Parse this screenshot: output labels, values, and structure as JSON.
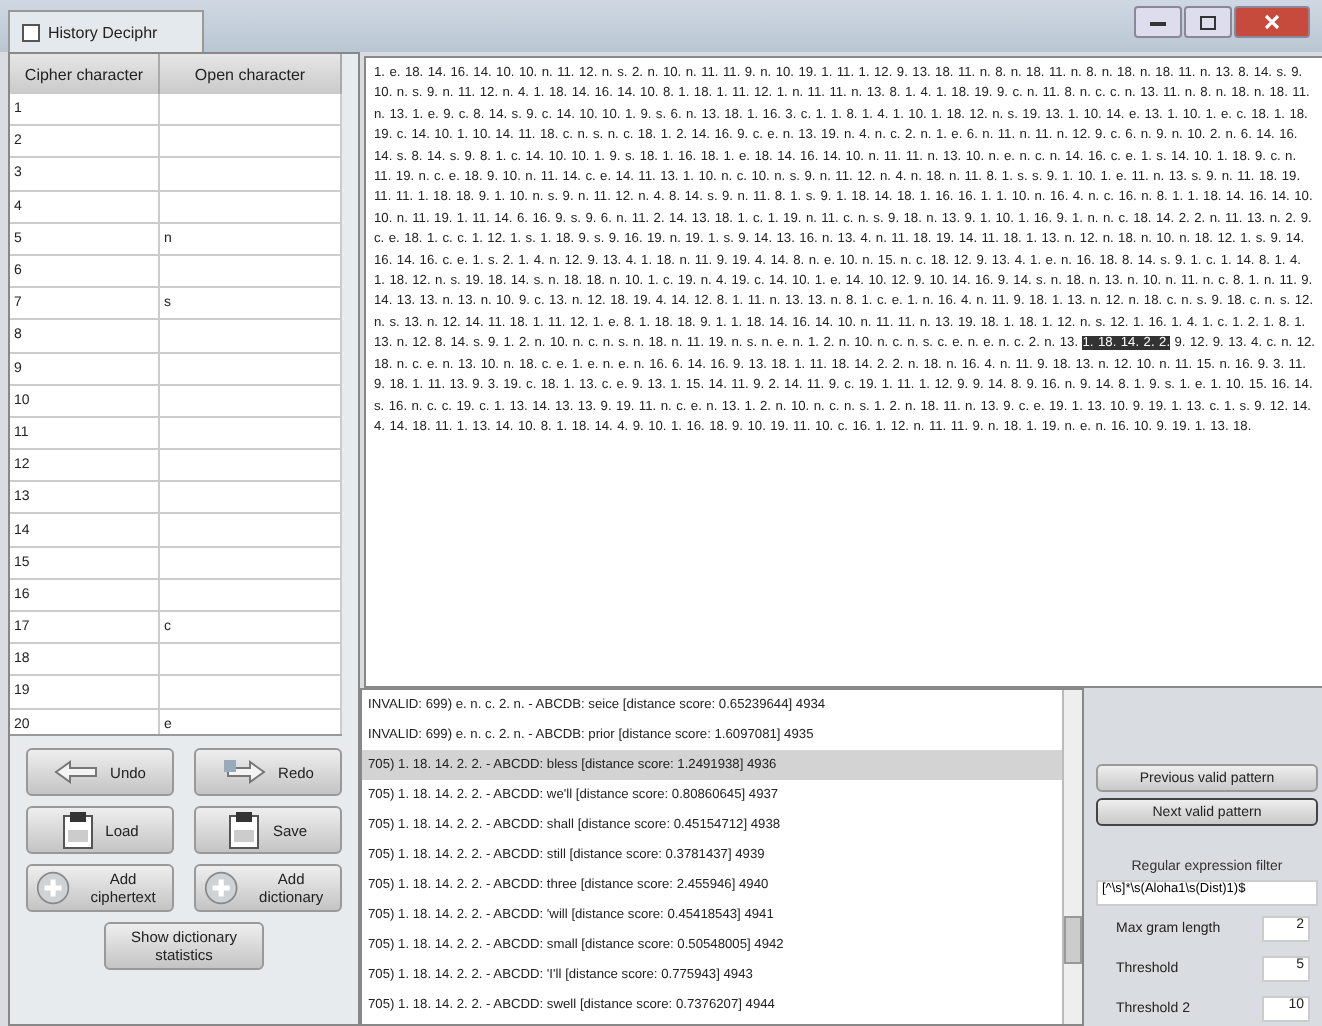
{
  "window": {
    "title": "History Deciphr"
  },
  "table": {
    "columns": [
      "Cipher character",
      "Open character"
    ],
    "rows": [
      {
        "cipher": "1"
      },
      {
        "cipher": "2"
      },
      {
        "cipher": "3"
      },
      {
        "cipher": "4"
      },
      {
        "cipher": "5",
        "open": "n"
      },
      {
        "cipher": "6"
      },
      {
        "cipher": "7",
        "open": "s"
      },
      {
        "cipher": "8"
      },
      {
        "cipher": "9"
      },
      {
        "cipher": "10"
      },
      {
        "cipher": "11"
      },
      {
        "cipher": "12"
      },
      {
        "cipher": "13"
      },
      {
        "cipher": "14"
      },
      {
        "cipher": "15"
      },
      {
        "cipher": "16"
      },
      {
        "cipher": "17",
        "open": "c"
      },
      {
        "cipher": "18"
      },
      {
        "cipher": "19"
      },
      {
        "cipher": "20",
        "open": "e"
      }
    ]
  },
  "buttons": [
    {
      "label": "Undo",
      "kind": "undo"
    },
    {
      "label": "Redo",
      "kind": "redo"
    },
    {
      "label": "Load",
      "kind": "load"
    },
    {
      "label": "Save",
      "kind": "save"
    },
    {
      "label": "Add ciphertext",
      "kind": "add"
    },
    {
      "label": "Add dictionary",
      "kind": "add"
    },
    {
      "label": "Show dictionary statistics",
      "kind": "text"
    }
  ],
  "cipher_text": {
    "before": "1. e. 18. 14. 16. 14. 10. 10. n. 11. 12. n. s. 2. n. 10. n. 11. 11. 9. n. 10. 19. 1. 11. 1. 12. 9. 13. 18. 11. n. 8. n. 18. 11. n. 8. n. 18. n. 18. 11. n. 13. 8. 14. s. 9. 10. n. s. 9. n. 11. 12. n. 4. 1. 18. 14. 16. 14. 10. 8. 1. 18. 1. 11. 12. 1. n. 11. 11. n. 13. 8. 1. 4. 1. 18. 19. 9. c. n. 11. 8. n. c. c. n. 13. 11. n. 8. n. 18. n. 18. 11. n. 13. 1. e. 9. c. 8. 14. s. 9. c. 14. 10. 10. 1. 9. s. 6. n. 13. 18. 1. 16. 3. c. 1. 1. 8. 1. 4. 1. 10. 1. 18. 12. n. s. 19. 13. 1. 10. 14. e. 13. 1. 10. 1. e. c. 18. 1. 18. 19. c. 14. 10. 1. 10. 14. 11. 18. c. n. s. n. c. 18. 1. 2. 14. 16. 9. c. e. n. 13. 19. n. 4. n. c. 2. n. 1. e. 6. n. 11. n. 11. n. 12. 9. c. 6. n. 9. n. 10. 2. n. 6. 14. 16. 14. s. 8. 14. s. 9. 8. 1. c. 14. 10. 10. 1. 9. s. 18. 1. 16. 18. 1. e. 18. 14. 16. 14. 10. n. 11. 11. n. 13. 10. n. e. n. c. n. 14. 16. c. e. 1. s. 14. 10. 1. 18. 9. c. n. 11. 19. n. c. e. 18. 9. 10. n. 11. 14. c. e. 14. 11. 13. 1. 10. n. c. 10. n. s. 9. n. 11. 12. n. 4. n. 18. n. 11. 8. 1. s. s. 9. 1. 10. 1. e. 11. n. 13. s. 9. n. 11. 18. 19. 11. 11. 1. 18. 18. 9. 1. 10. n. s. 9. n. 11. 12. n. 4. 8. 14. s. 9. n. 11. 8. 1. s. 9. 1. 18. 14. 18. 1. 16. 16. 1. 1. 10. n. 16. 4. n. c. 16. n. 8. 1. 1. 18. 14. 16. 14. 10. 10. n. 11. 19. 1. 11. 14. 6. 16. 9. s. 9. 6. n. 11. 2. 14. 13. 18. 1. c. 1. 19. n. 11. c. n. s. 9. 18. n. 13. 9. 1. 10. 1. 16. 9. 1. n. n. c. 18. 14. 2. 2. n. 11. 13. n. 2. 9. c. e. 18. 1. c. c. 1. 12. 1. s. 1. 18. 9. s. 9. 16. 19. n. 19. 1. s. 9. 14. 13. 16. n. 13. 4. n. 11. 18. 19. 14. 11. 18. 1. 13. n. 12. n. 18. n. 10. n. 18. 12. 1. s. 9. 14. 16. 14. 16. c. e. 1. s. 2. 1. 4. n. 12. 9. 13. 4. 1. 18. n. 11. 9. 19. 4. 14. 8. n. e. 10. n. 15. n. c. 18. 12. 9. 13. 4. 1. e. n. 16. 18. 8. 14. s. 9. 1. c. 1. 14. 8. 1. 4. 1. 18. 12. n. s. 19. 18. 14. s. n. 18. 18. n. 10. 1. c. 19. n. 4. 19. c. 14. 10. 1. e. 14. 10. 12. 9. 10. 14. 16. 9. 14. s. n. 18. n. 13. n. 10. n. 11. n. c. 8. 1. n. 11. 9. 14. 13. 13. n. 13. n. 10. 9. c. 13. n. 12. 18. 19. 4. 14. 12. 8. 1. 11. n. 13. 13. n. 8. 1. c. e. 1. n. 16. 4. n. 11. 9. 18. 1. 13. n. 12. n. 18. c. n. s. 9. 18. c. n. s. 12. n. s. 13. n. 12. 14. 11. 18. 1. 11. 12. 1. e. 8. 1. 18. 18. 9. 1. 1. 18. 14. 16. 14. 10. n. 11. 11. n. 13. 19. 18. 1. 18. 1. 12. n. s. 12. 1. 16. 1. 4. 1. c. 1. 2. 1. 8. 1. 13. n. 12. 8. 14. s. 9. 1. 2. n. 10. n. c. n. s. n. 18. n. 11. 19. n. s. n. e. n. 1. 2. n. 10. n. c. n. s. c. e. n. e. n. c. 2. n. 13.",
    "highlight": "1. 18. 14. 2. 2.",
    "after": "9. 12. 9. 13. 4. c. n. 12. 18. n. c. e. n. 13. 10. n. 18. c. e. 1. e. n. e. n. 16. 6. 14. 16. 9. 13. 18. 1. 11. 18. 14. 2. 2. n. 18. n. 16. 4. n. 11. 9. 18. 13. n. 12. 10. n. 11. 15. n. 16. 9. 3. 11. 9. 18. 1. 11. 13. 9. 3. 19. c. 18. 1. 13. c. e. 9. 13. 1. 15. 14. 11. 9. 2. 14. 11. 9. c. 19. 1. 11. 1. 12. 9. 9. 14. 8. 9. 16. n. 9. 14. 8. 1. 9. s. 1. e. 1. 10. 15. 16. 14. s. 16. n. c. c. 19. c. 1. 13. 14. 13. 13. 9. 19. 11. n. c. e. n. 13. 1. 2. n. 10. n. c. n. s. 1. 2. n. 18. 11. n. 13. 9. c. e. 19. 1. 13. 10. 9. 19. 1. 13. c. 1. s. 9. 12. 14. 4. 14. 18. 11. 1. 13. 14. 10. 8. 1. 18. 14. 4. 9. 10. 1. 16. 18. 9. 10. 19. 11. 10. c. 16. 1. 12. n. 11. 11. 9. n. 18. 1. 19. n. e. n. 16. 10. 9. 19. 1. 13. 18."
  },
  "results": [
    {
      "text": "INVALID: 699) e. n. c. 2. n. - ABCDB: seice",
      "score": "[distance score: 0.65239644] 4934",
      "selected": false
    },
    {
      "text": "INVALID: 699) e. n. c. 2. n. - ABCDB: prior",
      "score": "[distance score: 1.6097081] 4935",
      "selected": false
    },
    {
      "text": "705) 1. 18. 14. 2. 2. - ABCDD: bless",
      "score": "[distance score: 1.2491938] 4936",
      "selected": true
    },
    {
      "text": "705) 1. 18. 14. 2. 2. - ABCDD: we'll",
      "score": "[distance score: 0.80860645] 4937",
      "selected": false
    },
    {
      "text": "705) 1. 18. 14. 2. 2. - ABCDD: shall",
      "score": "[distance score: 0.45154712] 4938",
      "selected": false
    },
    {
      "text": "705) 1. 18. 14. 2. 2. - ABCDD: still",
      "score": "[distance score: 0.3781437] 4939",
      "selected": false
    },
    {
      "text": "705) 1. 18. 14. 2. 2. - ABCDD: three",
      "score": "[distance score: 2.455946] 4940",
      "selected": false
    },
    {
      "text": "705) 1. 18. 14. 2. 2. - ABCDD: 'will",
      "score": "[distance score: 0.45418543] 4941",
      "selected": false
    },
    {
      "text": "705) 1. 18. 14. 2. 2. - ABCDD: small",
      "score": "[distance score: 0.50548005] 4942",
      "selected": false
    },
    {
      "text": "705) 1. 18. 14. 2. 2. - ABCDD: 'I'll",
      "score": "[distance score: 0.775943] 4943",
      "selected": false
    },
    {
      "text": "705) 1. 18. 14. 2. 2. - ABCDD: swell",
      "score": "[distance score: 0.7376207] 4944",
      "selected": false
    }
  ],
  "pattern_buttons": [
    "Previous valid pattern",
    "Next valid pattern"
  ],
  "regex_filter": {
    "label": "Regular expression filter",
    "value": "[^\\s]*\\s(Aloha1\\s(Dist)1)$"
  },
  "settings": [
    {
      "label": "Max gram length",
      "value": "2"
    },
    {
      "label": "Threshold",
      "value": "5"
    },
    {
      "label": "Threshold 2",
      "value": "10"
    }
  ]
}
